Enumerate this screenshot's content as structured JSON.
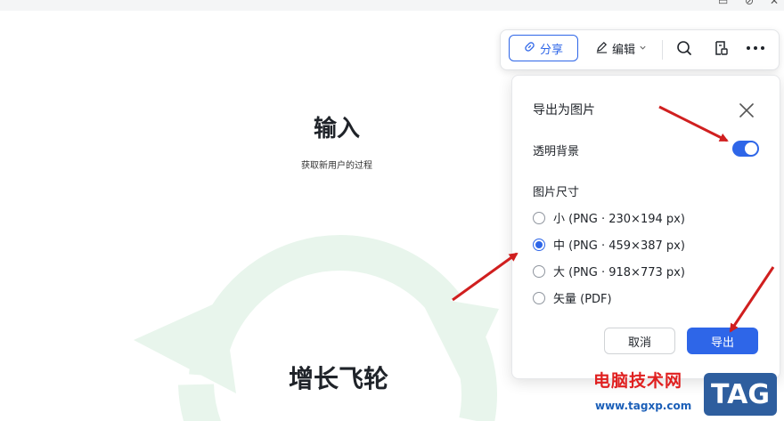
{
  "canvas": {
    "title_input": "输入",
    "subtitle": "获取新用户的过程",
    "title_growth": "增长飞轮"
  },
  "toolbar": {
    "share_label": "分享",
    "edit_label": "编辑",
    "icons": [
      "link-icon",
      "pencil-icon",
      "chevron-down-icon",
      "search-icon",
      "export-doc-icon",
      "more-icon"
    ]
  },
  "dialog": {
    "title": "导出为图片",
    "transparent_bg_label": "透明背景",
    "transparent_bg_on": true,
    "size_label": "图片尺寸",
    "options": [
      {
        "label": "小 (PNG · 230×194 px)",
        "checked": false
      },
      {
        "label": "中 (PNG · 459×387 px)",
        "checked": true
      },
      {
        "label": "大 (PNG · 918×773 px)",
        "checked": false
      },
      {
        "label": "矢量 (PDF)",
        "checked": false
      }
    ],
    "cancel_label": "取消",
    "export_label": "导出"
  },
  "watermark": {
    "site_name": "电脑技术网",
    "url": "www.tagxp.com",
    "tag": "TAG"
  },
  "colors": {
    "accent": "#2e66e8",
    "flywheel_green": "#e8f5ec",
    "arrow_red": "#d01f1f"
  }
}
